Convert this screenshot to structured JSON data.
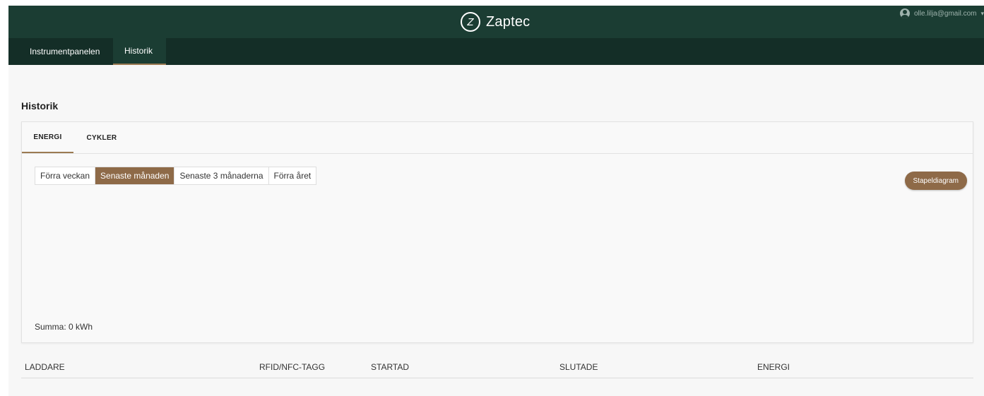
{
  "header": {
    "brand_logo": "Z",
    "brand_name": "Zaptec",
    "user_email": "olle.lilja@gmail.com",
    "user_icon": "user-circle-icon",
    "caret": "▾"
  },
  "nav": {
    "items": [
      {
        "label": "Instrumentpanelen"
      },
      {
        "label": "Historik",
        "active": true
      }
    ]
  },
  "page": {
    "title": "Historik"
  },
  "card": {
    "tabs": [
      {
        "label": "ENERGI",
        "active": true
      },
      {
        "label": "CYKLER"
      }
    ],
    "ranges": [
      {
        "label": "Förra veckan"
      },
      {
        "label": "Senaste månaden",
        "active": true
      },
      {
        "label": "Senaste 3 månaderna"
      },
      {
        "label": "Förra året"
      }
    ],
    "chart_toggle_label": "Stapeldiagram",
    "sum_label": "Summa: 0 kWh"
  },
  "table": {
    "columns": [
      "LADDARE",
      "RFID/NFC-TAGG",
      "STARTAD",
      "SLUTADE",
      "ENERGI"
    ]
  },
  "colors": {
    "header_bg": "#1b3d33",
    "nav_bg": "#142e27",
    "accent": "#8e6a48"
  }
}
